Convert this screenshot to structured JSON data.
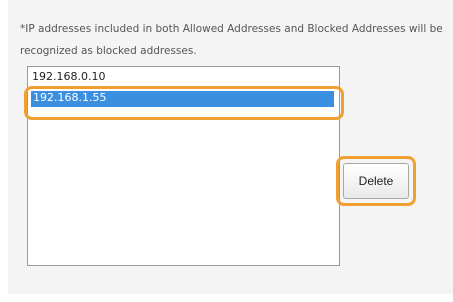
{
  "note": {
    "line1": "*IP addresses included in both Allowed Addresses and Blocked Addresses will be",
    "line2": "recognized as blocked addresses."
  },
  "address_list": {
    "items": [
      "192.168.0.10",
      "192.168.1.55"
    ],
    "selected_index": 1
  },
  "actions": {
    "delete_label": "Delete"
  },
  "colors": {
    "highlight": "#f0a030",
    "selection": "#3a8fe0"
  }
}
